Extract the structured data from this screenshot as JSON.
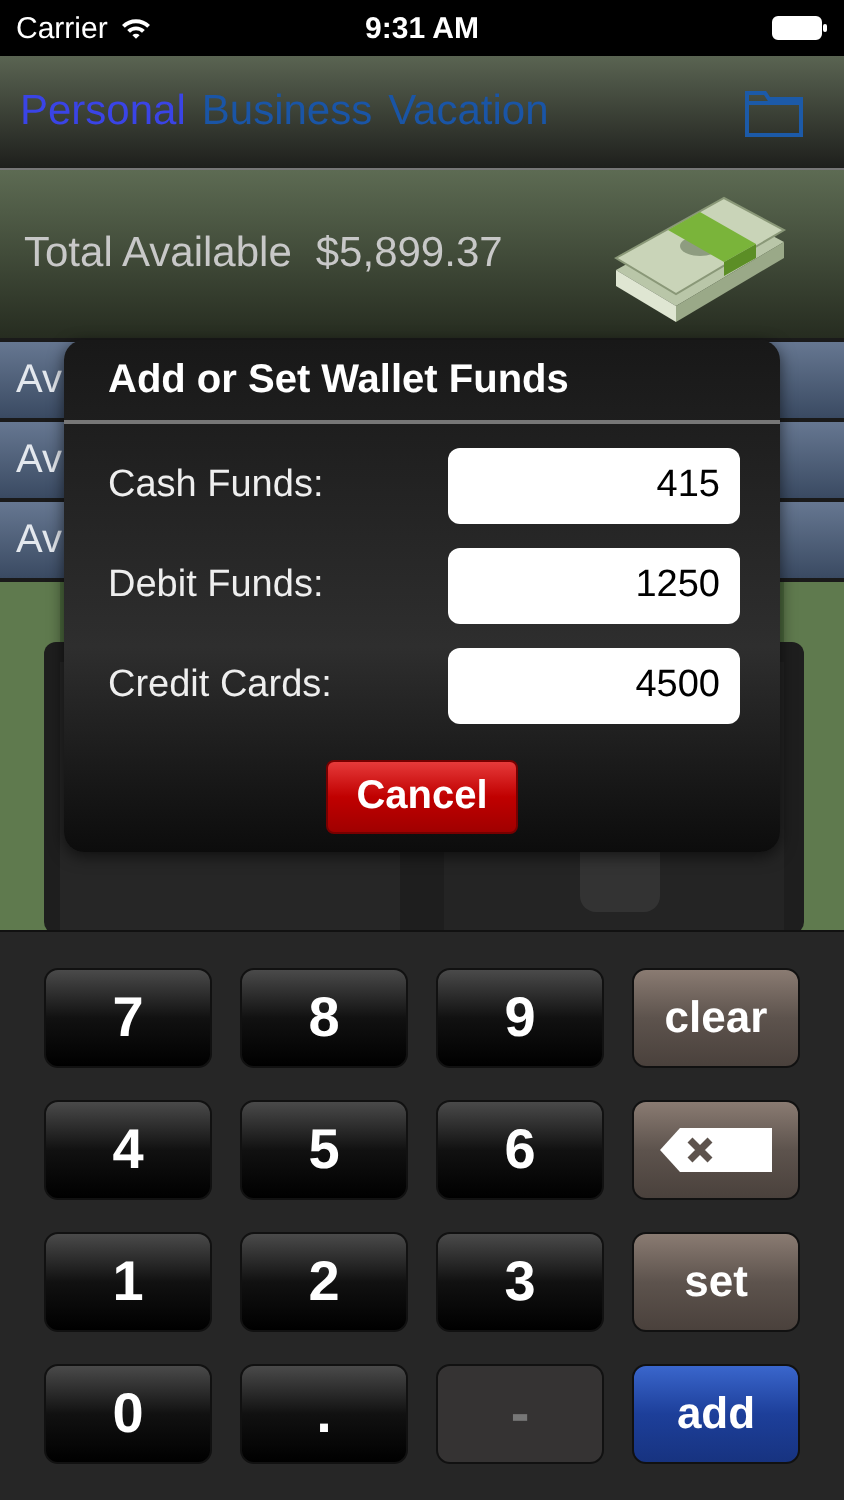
{
  "status_bar": {
    "carrier": "Carrier",
    "time": "9:31 AM"
  },
  "tabs": [
    {
      "label": "Personal",
      "selected": true
    },
    {
      "label": "Business",
      "selected": false
    },
    {
      "label": "Vacation",
      "selected": false
    }
  ],
  "total": {
    "label": "Total Available",
    "value": "$5,899.37"
  },
  "accounts": [
    {
      "label": "Av"
    },
    {
      "label": "Av"
    },
    {
      "label": "Av"
    }
  ],
  "dialog": {
    "title": "Add or Set Wallet Funds",
    "fields": [
      {
        "label": "Cash Funds:",
        "value": "415"
      },
      {
        "label": "Debit Funds:",
        "value": "1250"
      },
      {
        "label": "Credit Cards:",
        "value": "4500"
      }
    ],
    "cancel": "Cancel"
  },
  "keypad": [
    {
      "label": "7",
      "kind": "digit",
      "disabled": false
    },
    {
      "label": "8",
      "kind": "digit",
      "disabled": false
    },
    {
      "label": "9",
      "kind": "digit",
      "disabled": false
    },
    {
      "label": "clear",
      "kind": "function",
      "disabled": false
    },
    {
      "label": "4",
      "kind": "digit",
      "disabled": false
    },
    {
      "label": "5",
      "kind": "digit",
      "disabled": false
    },
    {
      "label": "6",
      "kind": "digit",
      "disabled": false
    },
    {
      "kind": "backspace",
      "disabled": false
    },
    {
      "label": "1",
      "kind": "digit",
      "disabled": false
    },
    {
      "label": "2",
      "kind": "digit",
      "disabled": false
    },
    {
      "label": "3",
      "kind": "digit",
      "disabled": false
    },
    {
      "label": "set",
      "kind": "function",
      "disabled": false
    },
    {
      "label": "0",
      "kind": "digit",
      "disabled": false
    },
    {
      "label": ".",
      "kind": "digit",
      "disabled": false
    },
    {
      "label": "-",
      "kind": "digit",
      "disabled": true
    },
    {
      "label": "add",
      "kind": "accent",
      "disabled": false
    }
  ]
}
